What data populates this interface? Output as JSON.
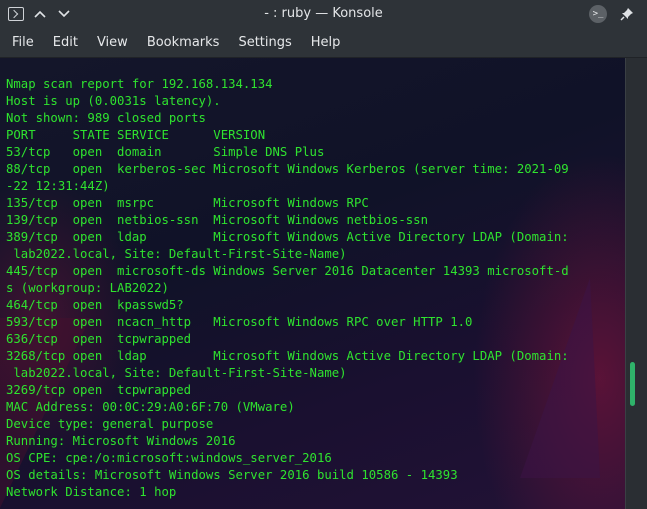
{
  "window": {
    "title": "- : ruby — Konsole",
    "app_icon": "terminal-icon",
    "buttons": [
      "chevron-up-icon",
      "chevron-down-icon",
      "terminal-badge-icon",
      "pin-icon"
    ]
  },
  "menu": {
    "items": [
      "File",
      "Edit",
      "View",
      "Bookmarks",
      "Settings",
      "Help"
    ]
  },
  "terminal": {
    "text_color": "#2fe32f",
    "lines": [
      "Nmap scan report for 192.168.134.134",
      "Host is up (0.0031s latency).",
      "Not shown: 989 closed ports",
      "PORT     STATE SERVICE      VERSION",
      "53/tcp   open  domain       Simple DNS Plus",
      "88/tcp   open  kerberos-sec Microsoft Windows Kerberos (server time: 2021-09",
      "-22 12:31:44Z)",
      "135/tcp  open  msrpc        Microsoft Windows RPC",
      "139/tcp  open  netbios-ssn  Microsoft Windows netbios-ssn",
      "389/tcp  open  ldap         Microsoft Windows Active Directory LDAP (Domain:",
      " lab2022.local, Site: Default-First-Site-Name)",
      "445/tcp  open  microsoft-ds Windows Server 2016 Datacenter 14393 microsoft-d",
      "s (workgroup: LAB2022)",
      "464/tcp  open  kpasswd5?",
      "593/tcp  open  ncacn_http   Microsoft Windows RPC over HTTP 1.0",
      "636/tcp  open  tcpwrapped",
      "3268/tcp open  ldap         Microsoft Windows Active Directory LDAP (Domain:",
      " lab2022.local, Site: Default-First-Site-Name)",
      "3269/tcp open  tcpwrapped",
      "MAC Address: 00:0C:29:A0:6F:70 (VMware)",
      "Device type: general purpose",
      "Running: Microsoft Windows 2016",
      "OS CPE: cpe:/o:microsoft:windows_server_2016",
      "OS details: Microsoft Windows Server 2016 build 10586 - 14393",
      "Network Distance: 1 hop"
    ]
  },
  "scrollbar": {
    "thumb_color": "#2fb36a"
  }
}
